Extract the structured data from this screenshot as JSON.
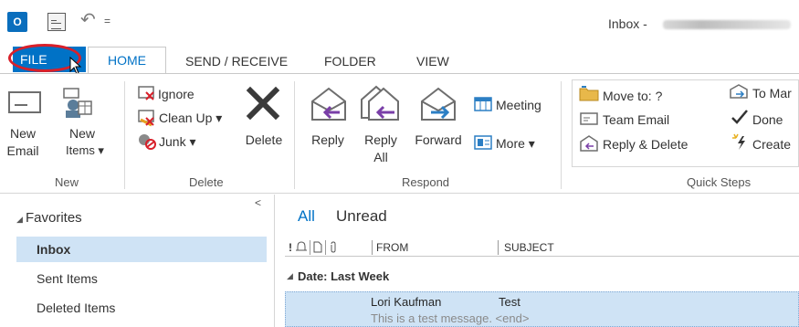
{
  "titlebar": {
    "window_title": "Inbox - ",
    "qat_dropdown": "="
  },
  "tabs": {
    "file": "FILE",
    "home": "HOME",
    "send_receive": "SEND / RECEIVE",
    "folder": "FOLDER",
    "view": "VIEW"
  },
  "ribbon": {
    "new_group": {
      "label": "New",
      "new_email": [
        "New",
        "Email"
      ],
      "new_items": [
        "New",
        "Items ▾"
      ]
    },
    "delete_group": {
      "label": "Delete",
      "ignore": "Ignore",
      "clean_up": "Clean Up ▾",
      "junk": "Junk ▾",
      "delete": "Delete"
    },
    "respond_group": {
      "label": "Respond",
      "reply": "Reply",
      "reply_all": [
        "Reply",
        "All"
      ],
      "forward": "Forward",
      "meeting": "Meeting",
      "more": "More ▾"
    },
    "quicksteps_group": {
      "label": "Quick Steps",
      "move_to": "Move to: ?",
      "team_email": "Team Email",
      "reply_delete": "Reply & Delete",
      "to_manager": "To Mar",
      "done": "Done",
      "create": "Create"
    }
  },
  "navpane": {
    "favorites": "Favorites",
    "items": [
      "Inbox",
      "Sent Items",
      "Deleted Items"
    ]
  },
  "msglist": {
    "filter_all": "All",
    "filter_unread": "Unread",
    "col_from": "FROM",
    "col_subject": "SUBJECT",
    "group_header": "Date: Last Week",
    "message": {
      "from": "Lori Kaufman",
      "subject": "Test",
      "preview": "This is a test message. <end>"
    }
  },
  "colors": {
    "accent": "#0072c6",
    "selection": "#cfe3f5",
    "annotation_circle": "#d8202a"
  }
}
